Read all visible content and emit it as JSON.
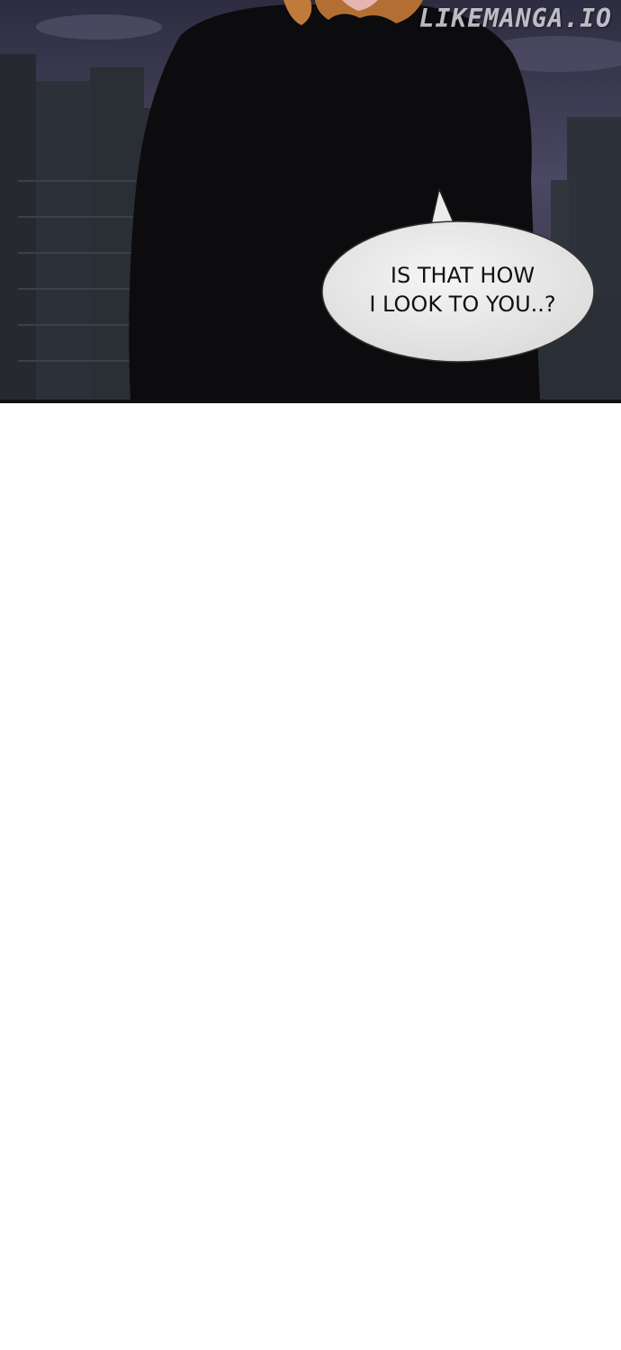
{
  "watermark": "LIKEMANGA.IO",
  "speech_bubble": {
    "line1": "IS THAT HOW",
    "line2": "I LOOK TO YOU..?"
  },
  "colors": {
    "sky": "#3a3850",
    "buildings": "#2c3038",
    "jacket": "#0c0b0d",
    "hair": "#c07a3a",
    "bubble": "#ebebeb"
  }
}
